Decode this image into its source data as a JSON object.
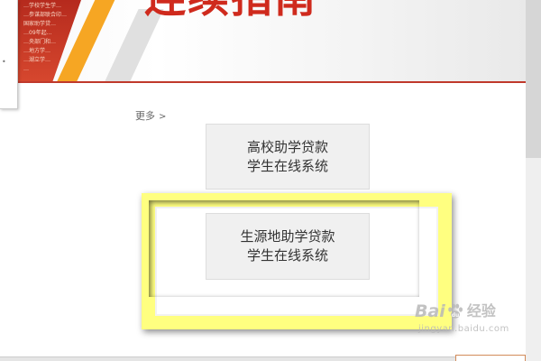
{
  "banner": {
    "heading": "连续指南",
    "news_lines": [
      "…学校学生学…",
      "…参谋部联合印…",
      "国家助学贷…",
      "…09年起…",
      "…央部门和…",
      "…地方学…",
      "…湖立学…",
      "…"
    ]
  },
  "more_link": {
    "label": "更多",
    "chevron": ">"
  },
  "buttons": [
    {
      "line1": "高校助学贷款",
      "line2": "学生在线系统"
    },
    {
      "line1": "生源地助学贷款",
      "line2": "学生在线系统"
    }
  ],
  "highlight": {
    "color": "#ffff80"
  },
  "watermark": {
    "logo_prefix": "Bai",
    "logo_suffix": "经验",
    "url": "jingyan.baidu.com",
    "icon": "paw-icon"
  },
  "colors": {
    "accent_red": "#cf2a1d",
    "accent_orange": "#f6a623"
  }
}
